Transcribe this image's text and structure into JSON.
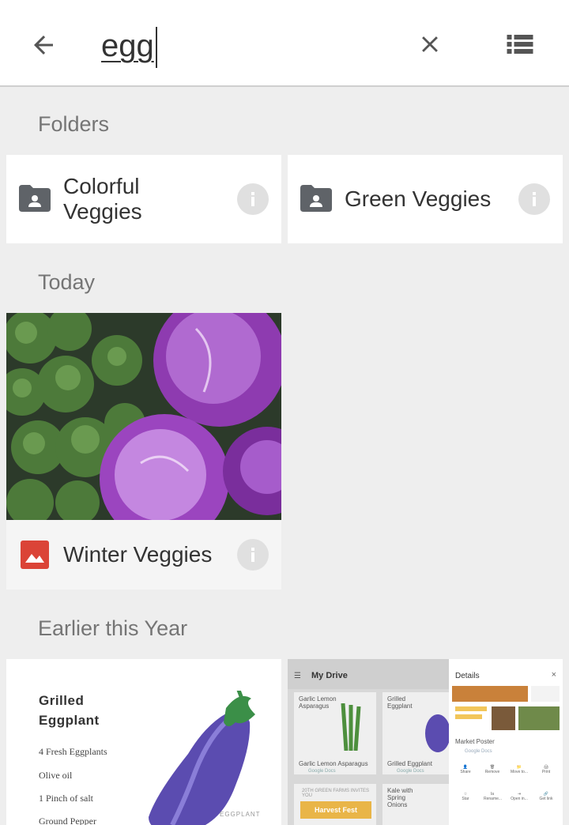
{
  "search": {
    "query": "egg",
    "back_icon": "arrow-back-icon",
    "clear_icon": "close-icon",
    "view_icon": "list-view-icon"
  },
  "sections": {
    "folders": "Folders",
    "today": "Today",
    "earlier": "Earlier this Year"
  },
  "folders": [
    {
      "name": "Colorful Veggies",
      "icon": "shared-folder-icon"
    },
    {
      "name": "Green Veggies",
      "icon": "shared-folder-icon"
    }
  ],
  "today_files": [
    {
      "name": "Winter Veggies",
      "icon": "image-file-icon"
    }
  ],
  "earlier_files": [
    {
      "title_line1": "Grilled",
      "title_line2": "Eggplant",
      "ingredients": [
        "4 Fresh Eggplants",
        "Olive oil",
        "1 Pinch of salt",
        "Ground Pepper"
      ],
      "watermark": "EGGPLANT"
    },
    {
      "app_title": "My Drive",
      "tiles": [
        {
          "title": "Garlic Lemon Asparagus",
          "caption": "Garlic Lemon Asparagus",
          "sub": "Google Docs"
        },
        {
          "title": "Grilled Eggplant",
          "caption": "Grilled Eggplant",
          "sub": "Google Docs"
        },
        {
          "title": "Kale with Spring Onions",
          "caption": "",
          "sub": ""
        }
      ],
      "flyer_text": "20TH GREEN FARMS INVITES YOU",
      "harvest_label": "Harvest Fest",
      "details_panel": {
        "title": "Details",
        "close": "×",
        "file_name": "Market Poster",
        "file_type": "Google Docs",
        "actions_row1": [
          "Share",
          "Remove",
          "Move to...",
          "Print"
        ],
        "actions_row2": [
          "Star",
          "Rename...",
          "Open in...",
          "Get link"
        ]
      }
    }
  ]
}
